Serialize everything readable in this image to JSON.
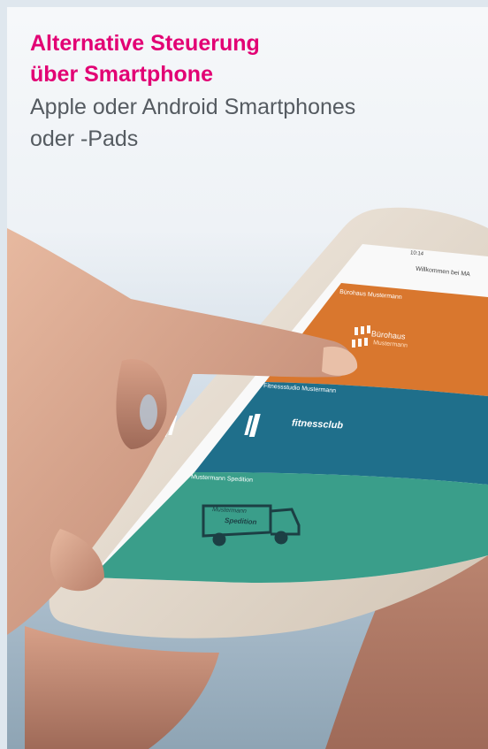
{
  "headline": {
    "line1": "Alternative Steuerung",
    "line2": "über Smartphone"
  },
  "subheadline": {
    "line1": "Apple oder Android Smartphones",
    "line2": "oder -Pads"
  },
  "phone_screen": {
    "status_time": "10:14",
    "welcome": "Willkommen bei MA",
    "tiles": [
      {
        "label": "Bürohaus Mustermann",
        "logo_line1": "Bürohaus",
        "logo_line2": "Mustermann",
        "color": "#d9772e"
      },
      {
        "label": "Fitnessstudio Mustermann",
        "logo": "fitnessclub",
        "color": "#1f6f8b"
      },
      {
        "label": "Mustermann Spedition",
        "logo_line1": "Mustermann",
        "logo_line2": "Spedition",
        "color": "#3a9e8a"
      }
    ]
  },
  "colors": {
    "brand_magenta": "#e20074",
    "sub_text_gray": "#555b61"
  }
}
